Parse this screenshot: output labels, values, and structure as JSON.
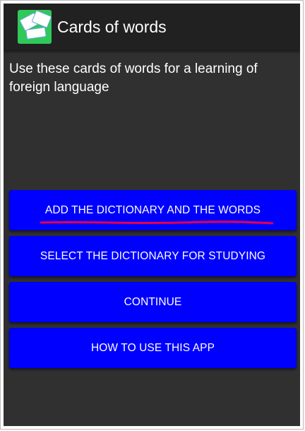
{
  "app": {
    "title": "Cards of words",
    "icon": "cards-app-icon"
  },
  "intro_text": "Use these cards of words for a learning of foreign language",
  "menu": {
    "add_dictionary_label": "ADD THE DICTIONARY AND THE WORDS",
    "select_dictionary_label": "SELECT THE DICTIONARY FOR STUDYING",
    "continue_label": "CONTINUE",
    "how_to_use_label": "HOW TO USE THIS APP"
  },
  "colors": {
    "background": "#303030",
    "appbar": "#212121",
    "button": "#0000ff",
    "annotation": "#e6004c"
  }
}
